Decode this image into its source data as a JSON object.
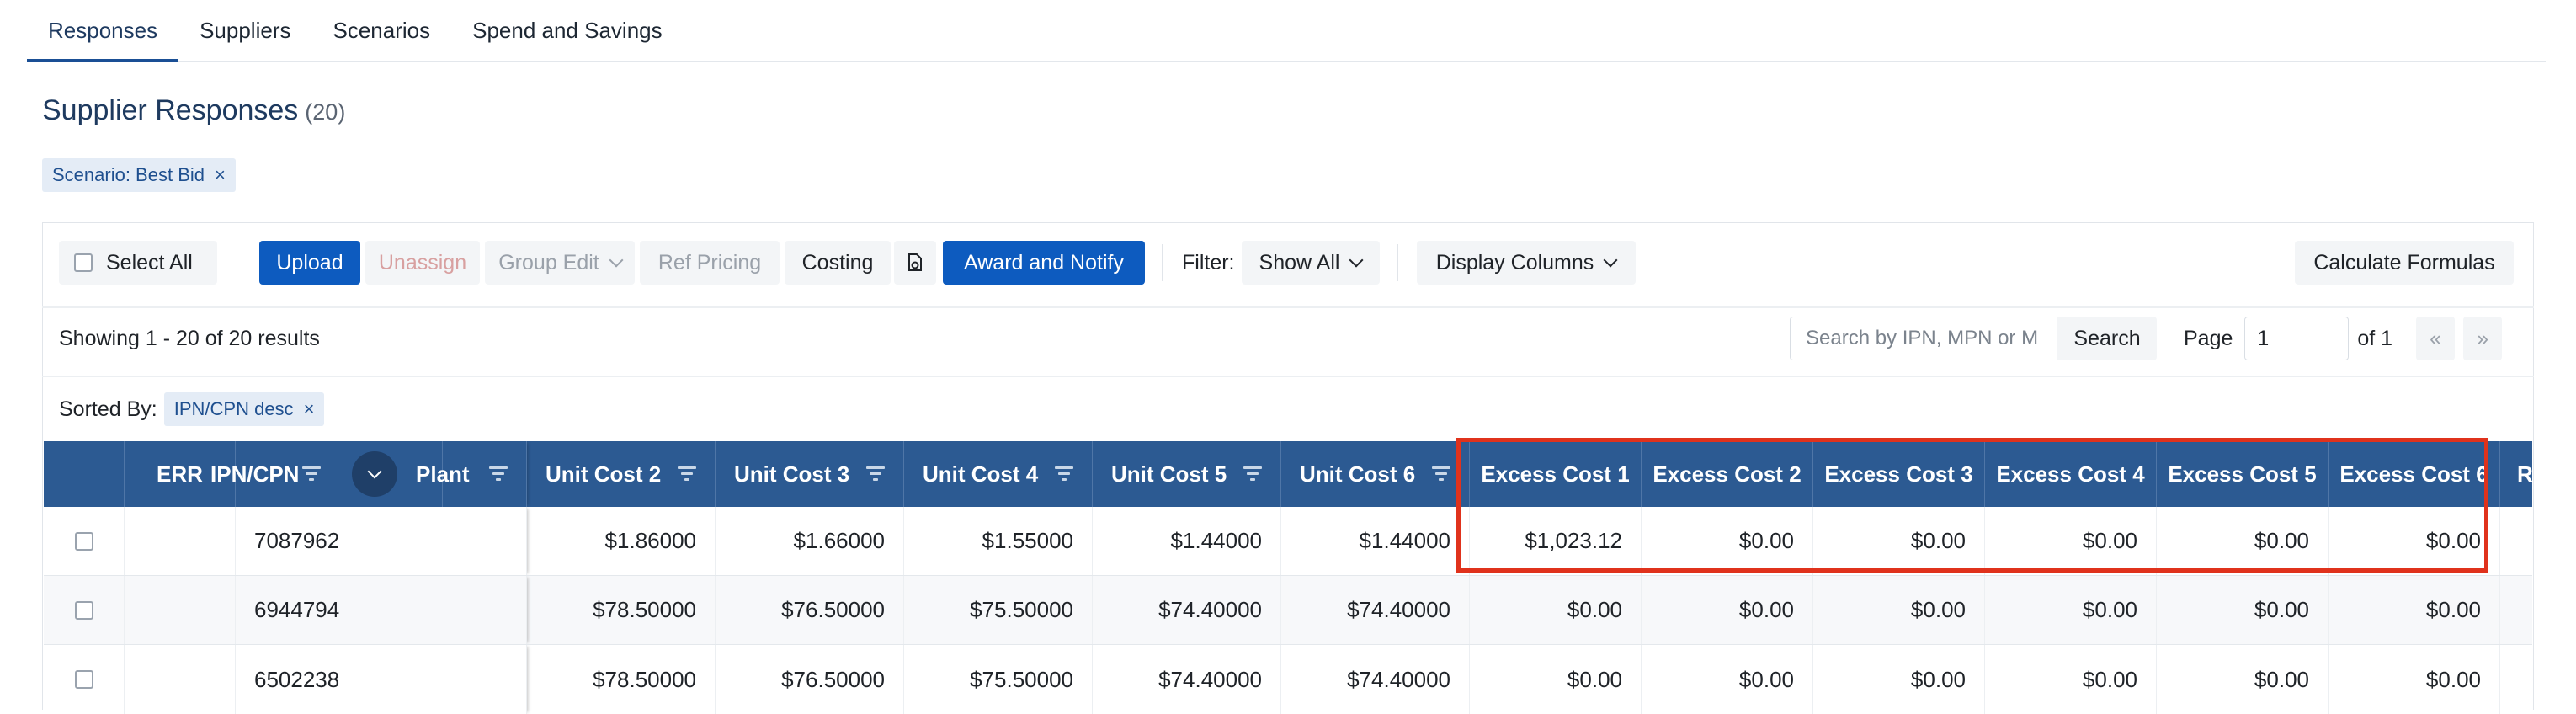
{
  "tabs": [
    "Responses",
    "Suppliers",
    "Scenarios",
    "Spend and Savings"
  ],
  "page_title": "Supplier Responses",
  "result_count": "(20)",
  "scenario_chip": "Scenario: Best Bid",
  "toolbar": {
    "select_all": "Select All",
    "upload": "Upload",
    "unassign": "Unassign",
    "group_edit": "Group Edit",
    "ref_pricing": "Ref Pricing",
    "costing": "Costing",
    "award_notify": "Award and Notify",
    "filter_label": "Filter:",
    "filter_value": "Show All",
    "display_columns": "Display Columns",
    "calculate_formulas": "Calculate Formulas"
  },
  "results_text": "Showing 1 - 20 of 20 results",
  "search": {
    "placeholder": "Search by IPN, MPN or M",
    "button": "Search"
  },
  "pagination": {
    "page_label": "Page",
    "page_value": "1",
    "of_label": "of 1",
    "prev": "«",
    "next": "»"
  },
  "sorted_by": {
    "label": "Sorted By:",
    "chip": "IPN/CPN desc"
  },
  "columns": [
    "ERR",
    "IPN/CPN",
    "Plant",
    "Unit Cost 2",
    "Unit Cost 3",
    "Unit Cost 4",
    "Unit Cost 5",
    "Unit Cost 6",
    "Excess Cost 1",
    "Excess Cost 2",
    "Excess Cost 3",
    "Excess Cost 4",
    "Excess Cost 5",
    "Excess Cost 6",
    "Ref"
  ],
  "rows": [
    {
      "ipn": "7087962",
      "values": [
        "$1.86000",
        "$1.66000",
        "$1.55000",
        "$1.44000",
        "$1.44000",
        "$1,023.12",
        "$0.00",
        "$0.00",
        "$0.00",
        "$0.00",
        "$0.00"
      ]
    },
    {
      "ipn": "6944794",
      "values": [
        "$78.50000",
        "$76.50000",
        "$75.50000",
        "$74.40000",
        "$74.40000",
        "$0.00",
        "$0.00",
        "$0.00",
        "$0.00",
        "$0.00",
        "$0.00"
      ]
    },
    {
      "ipn": "6502238",
      "values": [
        "$78.50000",
        "$76.50000",
        "$75.50000",
        "$74.40000",
        "$74.40000",
        "$0.00",
        "$0.00",
        "$0.00",
        "$0.00",
        "$0.00",
        "$0.00"
      ]
    }
  ],
  "colors": {
    "header_bg": "#2c5a92",
    "primary": "#0d5bbf",
    "highlight": "#e0321c"
  }
}
